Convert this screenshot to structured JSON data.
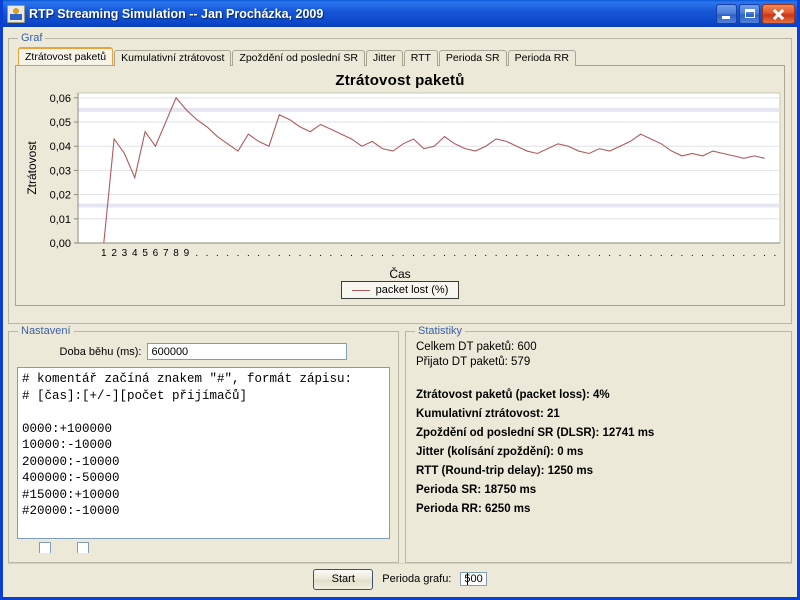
{
  "window": {
    "title": "RTP Streaming Simulation -- Jan Procházka, 2009",
    "icon": "app-icon",
    "buttons": {
      "minimize": "minimize-icon",
      "maximize": "maximize-icon",
      "close": "close-icon"
    }
  },
  "graf_panel": {
    "legend": "Graf"
  },
  "tabs": [
    {
      "label": "Ztrátovost paketů",
      "active": true
    },
    {
      "label": "Kumulativní ztrátovost",
      "active": false
    },
    {
      "label": "Zpoždění od poslední SR",
      "active": false
    },
    {
      "label": "Jitter",
      "active": false
    },
    {
      "label": "RTT",
      "active": false
    },
    {
      "label": "Perioda SR",
      "active": false
    },
    {
      "label": "Perioda RR",
      "active": false
    }
  ],
  "chart_data": {
    "type": "line",
    "title": "Ztrátovost paketů",
    "xlabel": "Čas",
    "ylabel": "Ztrátovost",
    "grid": true,
    "legend_position": "bottom",
    "line_color": "#b05a5a",
    "plot_bg": "#ffffff",
    "ylim": [
      0.0,
      0.062
    ],
    "ytick_labels": [
      "0,00",
      "0,01",
      "0,02",
      "0,03",
      "0,04",
      "0,05",
      "0,06"
    ],
    "ytick_values": [
      0.0,
      0.01,
      0.02,
      0.03,
      0.04,
      0.05,
      0.06
    ],
    "xtick_labels": [
      "1",
      "2",
      "3",
      "4",
      "5",
      "6",
      "7",
      "8",
      "9",
      ".",
      ".",
      ".",
      ".",
      ".",
      ".",
      ".",
      ".",
      ".",
      ".",
      ".",
      ".",
      ".",
      ".",
      ".",
      ".",
      ".",
      ".",
      ".",
      ".",
      ".",
      ".",
      ".",
      ".",
      ".",
      ".",
      ".",
      ".",
      ".",
      ".",
      ".",
      ".",
      ".",
      ".",
      ".",
      ".",
      ".",
      ".",
      ".",
      ".",
      ".",
      ".",
      ".",
      ".",
      ".",
      ".",
      ".",
      ".",
      ".",
      ".",
      ".",
      ".",
      ".",
      ".",
      ".",
      ".",
      ".",
      ".",
      ".",
      ".",
      ".",
      ".",
      ".",
      ".",
      ".",
      ".",
      ".",
      ".",
      ".",
      ".",
      ".",
      ".",
      ".",
      ".",
      ".",
      ".",
      ".",
      ".",
      ".",
      ".",
      ".",
      ".",
      ".",
      ".",
      ".",
      ".",
      "."
    ],
    "series": [
      {
        "name": "packet lost (%)",
        "values": [
          0.0,
          0.043,
          0.037,
          0.027,
          0.046,
          0.04,
          0.05,
          0.06,
          0.055,
          0.051,
          0.048,
          0.044,
          0.041,
          0.038,
          0.045,
          0.042,
          0.04,
          0.053,
          0.051,
          0.048,
          0.046,
          0.049,
          0.047,
          0.045,
          0.043,
          0.04,
          0.042,
          0.039,
          0.038,
          0.041,
          0.043,
          0.039,
          0.04,
          0.044,
          0.041,
          0.039,
          0.038,
          0.04,
          0.043,
          0.042,
          0.04,
          0.038,
          0.037,
          0.039,
          0.041,
          0.04,
          0.038,
          0.037,
          0.039,
          0.038,
          0.04,
          0.042,
          0.045,
          0.043,
          0.041,
          0.038,
          0.036,
          0.037,
          0.036,
          0.038,
          0.037,
          0.036,
          0.035,
          0.036,
          0.035
        ]
      }
    ]
  },
  "settings": {
    "legend": "Nastavení",
    "runtime_label": "Doba běhu (ms):",
    "runtime_value": "600000",
    "script_text": "# komentář začíná znakem \"#\", formát zápisu:\n# [čas]:[+/-][počet přijímačů]\n\n0000:+100000\n10000:-10000\n200000:-10000\n400000:-50000\n#15000:+10000\n#20000:-10000",
    "checkbox_left": "",
    "checkbox_right": ""
  },
  "statistics": {
    "legend": "Statistiky",
    "plain": [
      "Celkem DT paketů: 600",
      "Přijato DT paketů: 579"
    ],
    "bold": [
      "Ztrátovost paketů (packet loss): 4%",
      "Kumulativní ztrátovost: 21",
      "Zpoždění od poslední SR (DLSR): 12741 ms",
      "Jitter (kolísání zpoždění): 0 ms",
      "RTT (Round-trip delay): 1250 ms",
      "Perioda SR: 18750 ms",
      "Perioda RR: 6250 ms"
    ]
  },
  "bottom": {
    "start_label": "Start",
    "perioda_label": "Perioda grafu:",
    "perioda_value": "500"
  }
}
